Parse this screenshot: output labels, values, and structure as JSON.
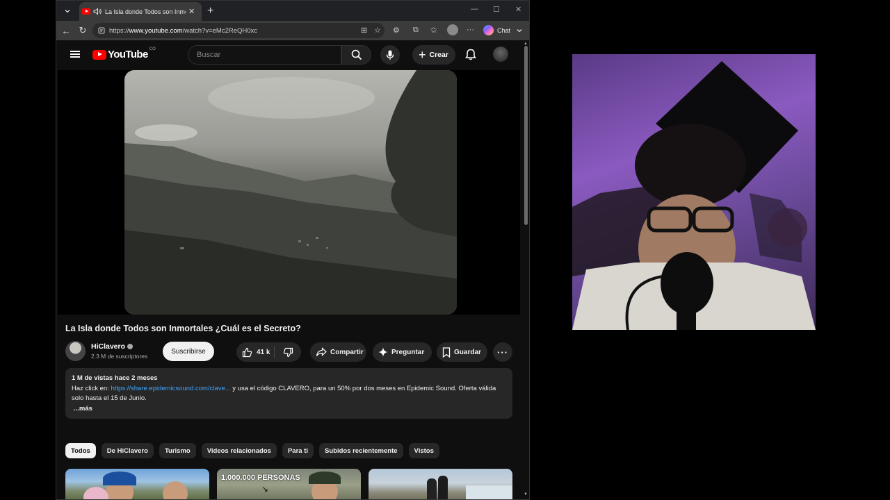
{
  "browser": {
    "tab_title": "La Isla donde Todos son Inmortales ¿Cuál es el Secreto? - YouTube",
    "url_prefix": "https://",
    "url_domain": "www.youtube.com",
    "url_path": "/watch?v=eMc2ReQH0xc",
    "chat_label": "Chat"
  },
  "youtube": {
    "logo_text": "YouTube",
    "logo_country": "CO",
    "search_placeholder": "Buscar",
    "create_label": "Crear"
  },
  "video": {
    "title": "La Isla donde Todos son Inmortales ¿Cuál es el Secreto?",
    "channel_name": "HiClavero",
    "subscribers": "2.3 M de suscriptores",
    "subscribe_label": "Suscribirse",
    "likes": "41 k",
    "share_label": "Compartir",
    "ask_label": "Preguntar",
    "save_label": "Guardar"
  },
  "description": {
    "meta": "1 M de vistas  hace 2 meses",
    "line1_prefix": "Haz click en: ",
    "link": "https://share.epidemicsound.com/clave...",
    "line1_suffix": " y usa el código CLAVERO, para un 50% por dos meses en Epidemic Sound. Oferta válida solo hasta el 15 de Junio.",
    "more": "...más"
  },
  "chips": [
    "Todos",
    "De HiClavero",
    "Turismo",
    "Videos relacionados",
    "Para ti",
    "Subidos recientemente",
    "Vistos"
  ],
  "thumbnails": {
    "second_overlay": "1.000.000 PERSONAS"
  },
  "colors": {
    "yt_red": "#ff0000",
    "page_bg": "#0f0f0f",
    "link_blue": "#3ea6ff"
  }
}
